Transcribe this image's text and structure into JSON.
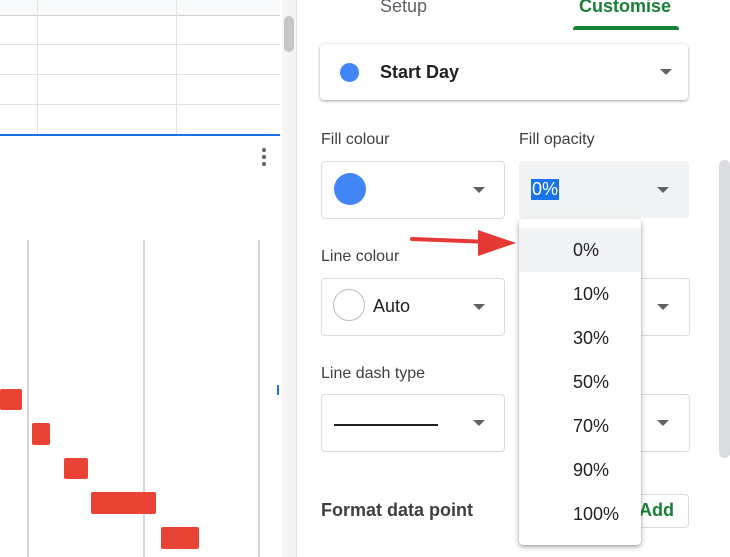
{
  "tabs": {
    "setup": "Setup",
    "customise": "Customise"
  },
  "series": {
    "selected": "Start Day",
    "color": "#4285f4"
  },
  "fill_colour": {
    "label": "Fill colour",
    "color": "#4285f4"
  },
  "fill_opacity": {
    "label": "Fill opacity",
    "value": "0%"
  },
  "line_colour": {
    "label": "Line colour",
    "value": "Auto"
  },
  "line_dash_type": {
    "label": "Line dash type"
  },
  "format_data_point": {
    "label": "Format data point",
    "add_button": "Add"
  },
  "opacity_menu": {
    "options": [
      "0%",
      "10%",
      "30%",
      "50%",
      "70%",
      "90%",
      "100%"
    ],
    "selected": "0%"
  },
  "colors": {
    "accent_green": "#188038",
    "highlight_blue": "#1a73e8",
    "bar_red": "#e84335",
    "arrow_red": "#e53935"
  }
}
